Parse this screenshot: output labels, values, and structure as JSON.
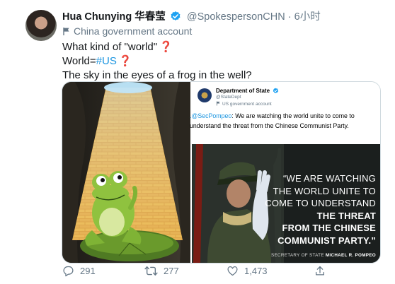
{
  "author": {
    "name": "Hua Chunying 华春莹",
    "handle": "@SpokespersonCHN",
    "separator": "·",
    "time": "6小时",
    "account_label": "China government account"
  },
  "tweet": {
    "line1": "What kind of \"world\"",
    "line1_mark": "❓",
    "line2_prefix": "World=",
    "line2_hashtag": "#US",
    "line2_mark": "❓",
    "line3": "The sky in the eyes of a frog in the well?"
  },
  "embedded_tweet": {
    "name": "Department of State",
    "handle": "@StateDept",
    "account_label": "US government account",
    "mention": ".@SecPompeo",
    "text": ": We are watching the world unite to come to understand the threat from the Chinese Communist Party.",
    "quote_line1": "“WE ARE WATCHING",
    "quote_line2": "THE WORLD UNITE TO",
    "quote_line3": "COME TO UNDERSTAND",
    "quote_line4": "THE THREAT",
    "quote_line5": "FROM THE CHINESE",
    "quote_line6": "COMMUNIST PARTY.”",
    "caption_prefix": "SECRETARY OF STATE",
    "caption_name": "MICHAEL R. POMPEO"
  },
  "actions": {
    "replies": "291",
    "retweets": "277",
    "likes": "1,473"
  },
  "colors": {
    "link": "#1b95e0",
    "verified": "#1da1f2",
    "secondary_text": "#657786",
    "question_mark": "#d0021b"
  }
}
